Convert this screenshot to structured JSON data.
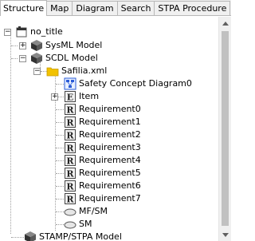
{
  "tabs": [
    {
      "label": "Structure",
      "active": true
    },
    {
      "label": "Map",
      "active": false
    },
    {
      "label": "Diagram",
      "active": false
    },
    {
      "label": "Search",
      "active": false
    },
    {
      "label": "STPA Procedure",
      "active": false
    }
  ],
  "tree": {
    "root": "no_title",
    "sysml_model": "SysML Model",
    "scdl_model": "SCDL Model",
    "file": "Safilia.xml",
    "safety_concept_diagram": "Safety Concept Diagram0",
    "item": "Item",
    "requirements": [
      "Requirement0",
      "Requirement1",
      "Requirement2",
      "Requirement3",
      "Requirement4",
      "Requirement5",
      "Requirement6",
      "Requirement7"
    ],
    "mfsm": "MF/SM",
    "sm": "SM",
    "stamp_stpa_model": "STAMP/STPA Model"
  },
  "icons": {
    "expand_plus": "+",
    "collapse_minus": "−",
    "item_badge": "E",
    "requirement_badge": "R"
  },
  "colors": {
    "folder": "#f2c200",
    "tab_active_bg": "#ffffff",
    "tab_bg": "#f0f0f0",
    "scroll_thumb": "#c1c1c1"
  }
}
